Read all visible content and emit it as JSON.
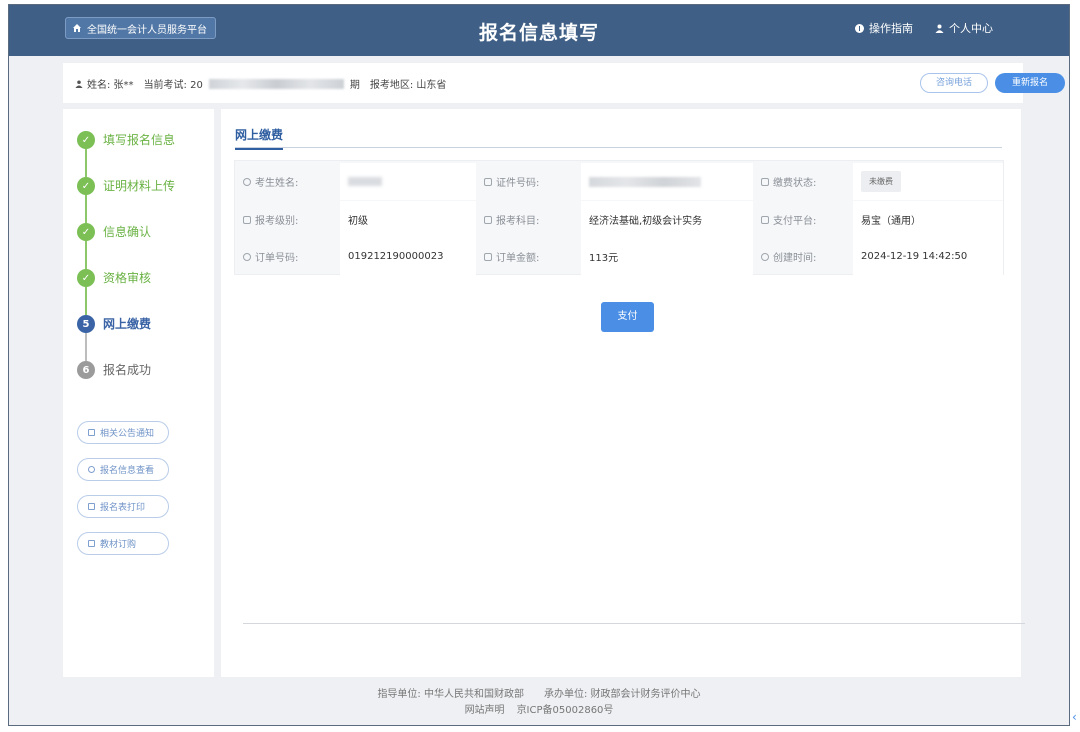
{
  "header": {
    "platform_button": "全国统一会计人员服务平台",
    "title": "报名信息填写",
    "guide": "操作指南",
    "personal_center": "个人中心"
  },
  "info": {
    "name": "姓名: 张**",
    "current_exam_prefix": "当前考试: 20",
    "current_exam_suffix": "期",
    "region": "报考地区: 山东省",
    "consult_button": "咨询电话",
    "reapply_button": "重新报名"
  },
  "steps": [
    {
      "num": "✓",
      "label": "填写报名信息",
      "state": "done"
    },
    {
      "num": "✓",
      "label": "证明材料上传",
      "state": "done"
    },
    {
      "num": "✓",
      "label": "信息确认",
      "state": "done"
    },
    {
      "num": "✓",
      "label": "资格审核",
      "state": "done"
    },
    {
      "num": "5",
      "label": "网上缴费",
      "state": "current"
    },
    {
      "num": "6",
      "label": "报名成功",
      "state": "todo"
    }
  ],
  "quick_links": [
    "相关公告通知",
    "报名信息查看",
    "报名表打印",
    "教材订购"
  ],
  "tab": {
    "title": "网上缴费"
  },
  "payment_table": {
    "row1": {
      "label1": "考生姓名:",
      "label2": "证件号码:",
      "label3": "缴费状态:",
      "status": "未缴费"
    },
    "row2": {
      "label1": "报考级别:",
      "value1": "初级",
      "label2": "报考科目:",
      "value2": "经济法基础,初级会计实务",
      "label3": "支付平台:",
      "value3": "易宝（通用）"
    },
    "row3": {
      "label1": "订单号码:",
      "value1": "019212190000023",
      "label2": "订单金额:",
      "value2": "113元",
      "label3": "创建时间:",
      "value3": "2024-12-19 14:42:50"
    }
  },
  "pay_button": "支付",
  "footer": {
    "line1": "指导单位: 中华人民共和国财政部　　承办单位: 财政部会计财务评价中心",
    "statement": "网站声明",
    "icp": "京ICP备05002860号"
  },
  "colors": {
    "header_bg": "#3f5f86",
    "accent": "#4a8ee5",
    "done_green": "#7bbf55"
  }
}
